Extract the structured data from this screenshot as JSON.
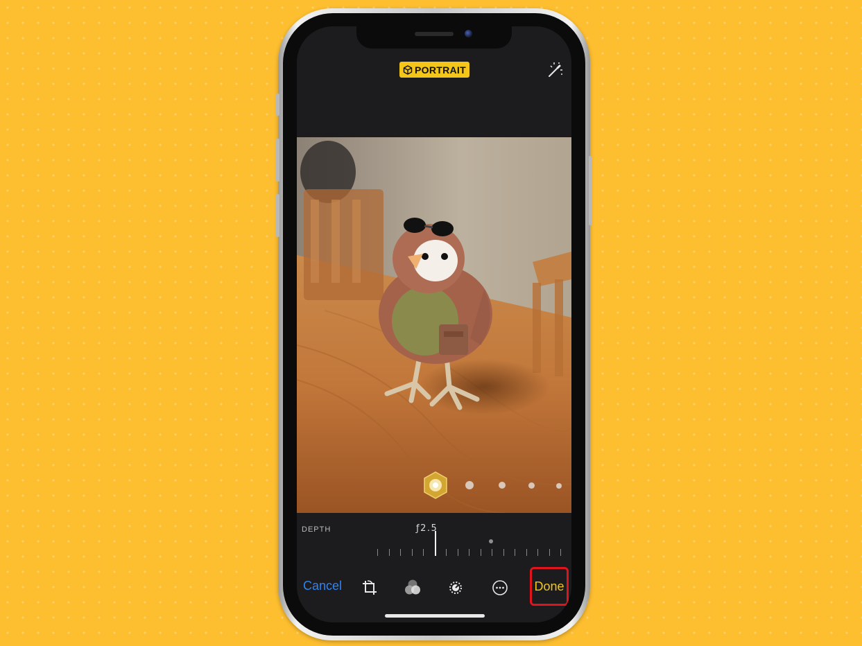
{
  "header": {
    "mode_badge": "PORTRAIT",
    "mode_icon": "cube-icon",
    "auto_enhance_icon": "magic-wand-icon"
  },
  "photo": {
    "depth_selector_icon": "aperture-icon"
  },
  "depth_control": {
    "label": "DEPTH",
    "value": "ƒ2.5"
  },
  "toolbar": {
    "cancel_label": "Cancel",
    "done_label": "Done",
    "icons": [
      "crop-rotate-icon",
      "filters-icon",
      "adjust-icon",
      "more-icon"
    ]
  },
  "colors": {
    "background": "#FDBE30",
    "accent_yellow": "#F4C61A",
    "cancel_blue": "#2d84f5",
    "highlight_red": "#e0141c"
  }
}
